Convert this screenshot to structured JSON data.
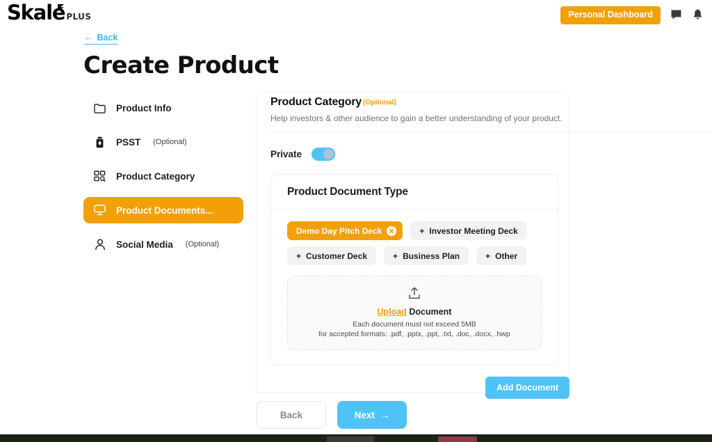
{
  "brand": {
    "word": "Skale",
    "suffix": "PLUS"
  },
  "topbar": {
    "dashboard_button": "Personal Dashboard",
    "message_icon": "message-icon",
    "bell_icon": "bell-icon"
  },
  "back_link": {
    "label": "Back",
    "arrow": "←"
  },
  "page_title": "Create Product",
  "sidebar": {
    "items": [
      {
        "label": "Product Info",
        "optional": "",
        "icon": "folder-icon",
        "active": false
      },
      {
        "label": "PSST",
        "optional": "(Optional)",
        "icon": "bottle-icon",
        "active": false
      },
      {
        "label": "Product Category",
        "optional": "",
        "icon": "grid-search-icon",
        "active": false
      },
      {
        "label": "Product Documents...",
        "optional": "",
        "icon": "monitor-icon",
        "active": true
      },
      {
        "label": "Social Media",
        "optional": "(Optional)",
        "icon": "person-icon",
        "active": false
      }
    ]
  },
  "section": {
    "title": "Product Category",
    "optional_tag": "(Optional)",
    "subtitle": "Help investors & other audience to gain a better understanding of your product.",
    "privacy_toggle": {
      "label": "Private",
      "state": "on"
    }
  },
  "card": {
    "title": "Product Document Type",
    "chips": [
      {
        "label": "Demo Day Pitch Deck",
        "selected": true,
        "remove_icon": "close-circle-icon"
      },
      {
        "label": "Investor Meeting Deck",
        "selected": false,
        "prefix": "+"
      },
      {
        "label": "Customer Deck",
        "selected": false,
        "prefix": "+"
      },
      {
        "label": "Business Plan",
        "selected": false,
        "prefix": "+"
      },
      {
        "label": "Other",
        "selected": false,
        "prefix": "+"
      }
    ],
    "upload": {
      "icon": "upload-icon",
      "link_text": "Upload",
      "label_rest": " Document",
      "hint_size": "Each document must not exceed 5MB",
      "hint_formats": "for accepted formats: .pdf, .pptx, .ppt, .txt, .doc, .docx, .hwp"
    },
    "add_button": "Add Document"
  },
  "wizard": {
    "back_label": "Back",
    "next_label": "Next",
    "next_arrow": "→"
  },
  "colors": {
    "brand_orange": "#F2A009",
    "accent_blue": "#4FC3F7",
    "link_blue": "#3EB7F0",
    "chip_grey": "#F2F2F2",
    "text_dark": "#1d1d1d",
    "text_muted": "#6d7278"
  }
}
